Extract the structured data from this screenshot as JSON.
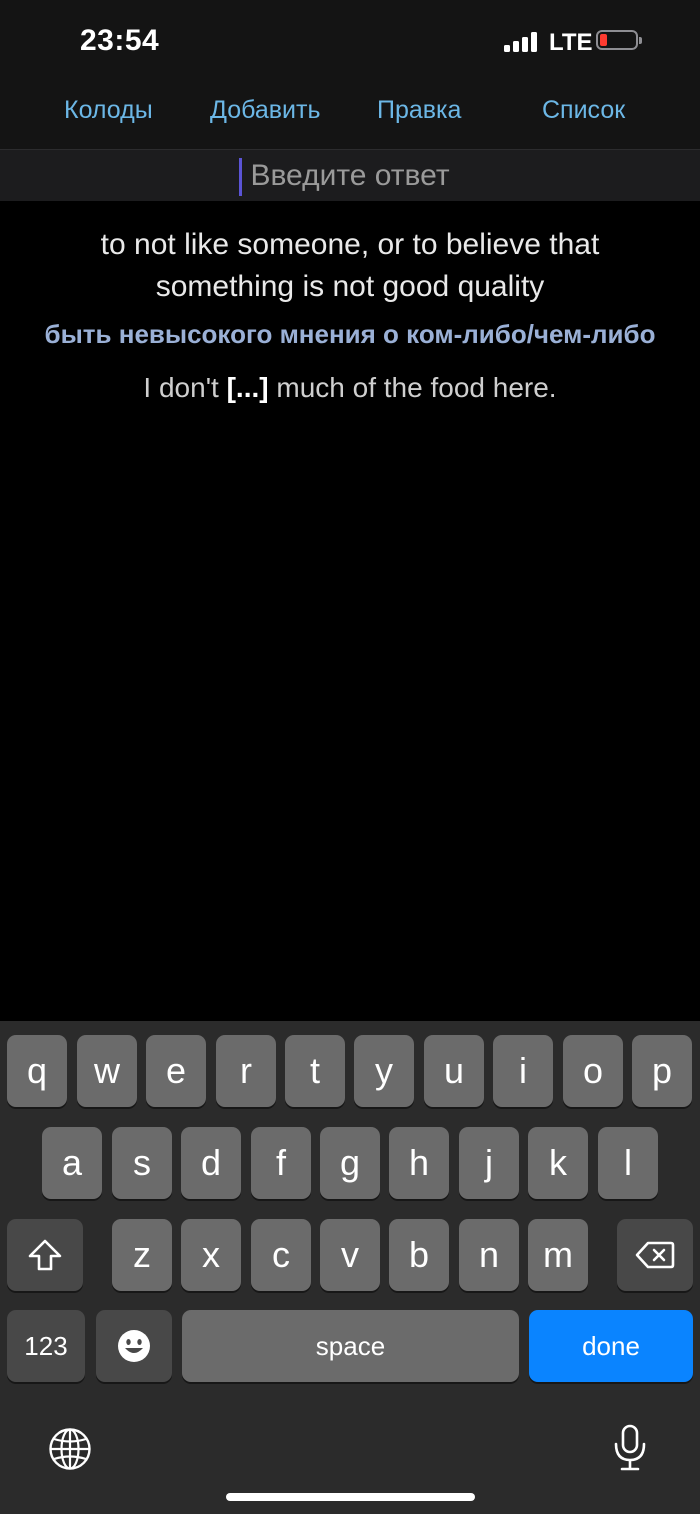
{
  "status_bar": {
    "time": "23:54",
    "network": "LTE",
    "battery_color": "#ff3b30"
  },
  "nav": {
    "decks": "Колоды",
    "add": "Добавить",
    "edit": "Правка",
    "list": "Список"
  },
  "answer": {
    "placeholder": "Введите ответ",
    "value": ""
  },
  "card": {
    "definition": "to not like someone, or to believe that something is not good quality",
    "translation": "быть невысокого мнения о ком-либо/чем-либо",
    "example_before": "I don't ",
    "example_cloze": "[...]",
    "example_after": " much of the food here."
  },
  "keyboard": {
    "row1": [
      "q",
      "w",
      "e",
      "r",
      "t",
      "y",
      "u",
      "i",
      "o",
      "p"
    ],
    "row2": [
      "a",
      "s",
      "d",
      "f",
      "g",
      "h",
      "j",
      "k",
      "l"
    ],
    "row3": [
      "z",
      "x",
      "c",
      "v",
      "b",
      "n",
      "m"
    ],
    "numbers_label": "123",
    "space_label": "space",
    "done_label": "done",
    "accent_color": "#0a84ff"
  },
  "icons": {
    "shift": "shift-icon",
    "backspace": "backspace-icon",
    "emoji": "emoji-icon",
    "globe": "globe-icon",
    "mic": "microphone-icon"
  }
}
